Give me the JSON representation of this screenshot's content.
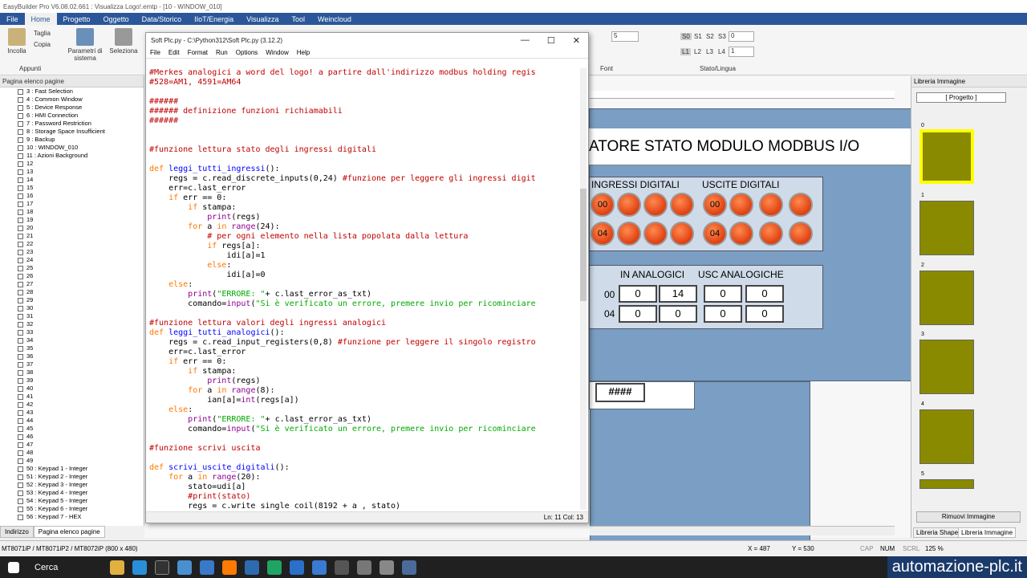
{
  "window": {
    "title": "EasyBuilder Pro V6.08.02.661 : Visualizza Logo!.emtp - [10 - WINDOW_010]"
  },
  "menu": [
    "File",
    "Home",
    "Progetto",
    "Oggetto",
    "Data/Storico",
    "IIoT/Energia",
    "Visualizza",
    "Tool",
    "Weincloud"
  ],
  "ribbon": {
    "incolla": "Incolla",
    "taglia": "Taglia",
    "copia": "Copia",
    "appunti": "Appunti",
    "parametri": "Parametri di sistema",
    "seleziona": "Seleziona",
    "font": "Font",
    "stato": "Stato/Lingua",
    "s0": "S0",
    "s1": "S1",
    "s2": "S2",
    "s3": "S3",
    "l1": "L1",
    "l2": "L2",
    "l3": "L3",
    "l4": "L4",
    "sval": "0",
    "lval": "1",
    "fsize": "5"
  },
  "leftpane": {
    "header": "Pagina elenco pagine",
    "items": [
      "3 : Fast Selection",
      "4 : Common Window",
      "5 : Device Response",
      "6 : HMI Connection",
      "7 : Password Restriction",
      "8 : Storage Space Insufficient",
      "9 : Backup",
      "10 : WINDOW_010",
      "11 : Azioni Background",
      "12",
      "13",
      "14",
      "15",
      "16",
      "17",
      "18",
      "19",
      "20",
      "21",
      "22",
      "23",
      "24",
      "25",
      "26",
      "27",
      "28",
      "29",
      "30",
      "31",
      "32",
      "33",
      "34",
      "35",
      "36",
      "37",
      "38",
      "39",
      "40",
      "41",
      "42",
      "43",
      "44",
      "45",
      "46",
      "47",
      "48",
      "49",
      "50 : Keypad 1 - Integer",
      "51 : Keypad 2 - Integer",
      "52 : Keypad 3 - Integer",
      "53 : Keypad 4 - Integer",
      "54 : Keypad 5 - Integer",
      "55 : Keypad 6 - Integer",
      "56 : Keypad 7 - HEX"
    ],
    "tab1": "Indirizzo",
    "tab2": "Pagina elenco pagine"
  },
  "editor": {
    "title": "Soft Plc.py - C:\\Python312\\Soft Plc.py (3.12.2)",
    "menu": [
      "File",
      "Edit",
      "Format",
      "Run",
      "Options",
      "Window",
      "Help"
    ],
    "status": "Ln: 11    Col: 13"
  },
  "hmi": {
    "title": "ATORE STATO MODULO MODBUS I/O",
    "ingressi": "INGRESSI DIGITALI",
    "uscite": "USCITE DIGITALI",
    "in_an": "IN ANALOGICI",
    "usc_an": "USC ANALOGICHE",
    "r0": "00",
    "r1": "04",
    "led00": "00",
    "led04": "04",
    "a": [
      "0",
      "14",
      "0",
      "0"
    ],
    "b": [
      "0",
      "0",
      "0",
      "0"
    ],
    "hash": "####"
  },
  "rightpane": {
    "header": "Libreria Immagine",
    "select": "[ Progetto ]",
    "thumbs": [
      "0",
      "1",
      "2",
      "3",
      "4",
      "5"
    ],
    "remove": "Rimuovi Immagine",
    "tab1": "Libreria Shape",
    "tab2": "Libreria Immagine"
  },
  "status": {
    "model": "MT8071iP / MT8071iP2 / MT8072iP (800 x 480)",
    "x": "X = 487",
    "y": "Y = 530",
    "cap": "CAP",
    "num": "NUM",
    "scrl": "SCRL",
    "zoom": "125 %"
  },
  "taskbar": {
    "search": "Cerca",
    "brand": "automazione-plc.it"
  }
}
